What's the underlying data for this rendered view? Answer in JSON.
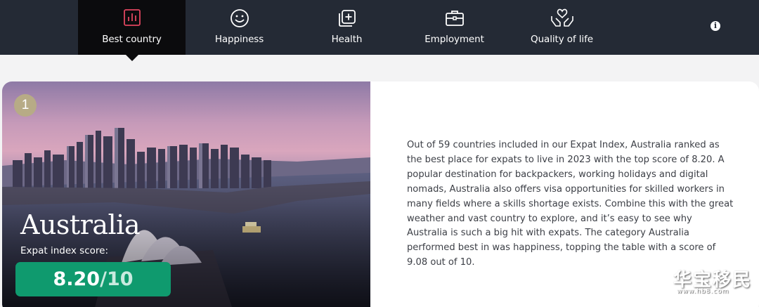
{
  "nav": {
    "tabs": [
      {
        "label": "Best country",
        "icon": "bar-chart-icon",
        "active": true
      },
      {
        "label": "Happiness",
        "icon": "smiley-icon",
        "active": false
      },
      {
        "label": "Health",
        "icon": "medical-cross-icon",
        "active": false
      },
      {
        "label": "Employment",
        "icon": "briefcase-icon",
        "active": false
      },
      {
        "label": "Quality of life",
        "icon": "hands-heart-icon",
        "active": false
      }
    ],
    "info_icon": "info-icon",
    "info_glyph": "i"
  },
  "card": {
    "rank": "1",
    "country": "Australia",
    "score_label": "Expat index score:",
    "score_value": "8.20",
    "score_max": "/10",
    "description": "Out of 59 countries included in our Expat Index, Australia ranked as the best place for expats to live in 2023 with the top score of 8.20. A popular destination for backpackers, working holidays and digital nomads, Australia also offers visa opportunities for skilled workers in many fields where a skills shortage exists. Combine this with the great weather and vast country to explore, and it’s easy to see why Australia is such a big hit with expats. The category Australia performed best in was happiness, topping the table with a score of 9.08 out of 10."
  },
  "watermark": {
    "text": "华宝移民",
    "url": "www.hb8.com"
  },
  "colors": {
    "nav_bg": "#242a35",
    "active_tab_bg": "#0b0b0d",
    "active_icon": "#e0455f",
    "score_green": "#0f9a6e",
    "rank_badge": "#b7ab86"
  }
}
